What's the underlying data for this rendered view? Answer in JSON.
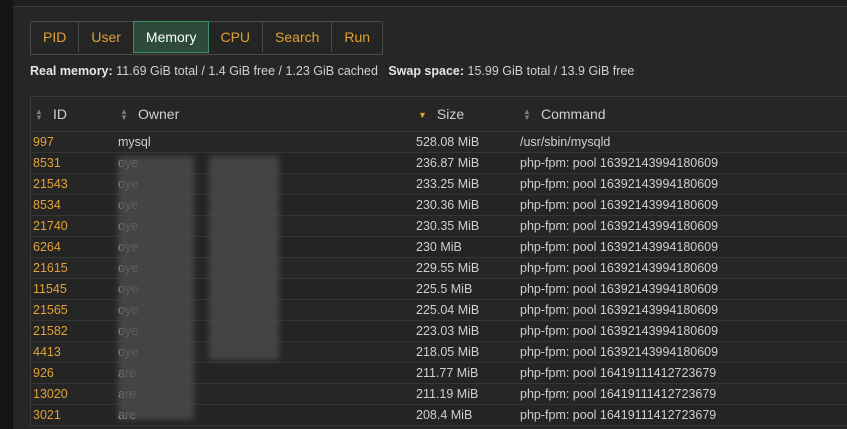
{
  "tabs": [
    {
      "label": "PID",
      "active": false
    },
    {
      "label": "User",
      "active": false
    },
    {
      "label": "Memory",
      "active": true
    },
    {
      "label": "CPU",
      "active": false
    },
    {
      "label": "Search",
      "active": false
    },
    {
      "label": "Run",
      "active": false
    }
  ],
  "memory": {
    "real_label": "Real memory:",
    "real_value": "11.69 GiB total / 1.4 GiB free / 1.23 GiB cached",
    "swap_label": "Swap space:",
    "swap_value": "15.99 GiB total / 13.9 GiB free"
  },
  "table": {
    "columns": {
      "id": "ID",
      "owner": "Owner",
      "size": "Size",
      "command": "Command"
    },
    "sorted_by": "Size",
    "rows": [
      {
        "id": "997",
        "owner": "mysql",
        "size": "528.08 MiB",
        "command": "/usr/sbin/mysqld"
      },
      {
        "id": "8531",
        "owner": "oye",
        "size": "236.87 MiB",
        "command": "php-fpm: pool 16392143994180609"
      },
      {
        "id": "21543",
        "owner": "oye",
        "size": "233.25 MiB",
        "command": "php-fpm: pool 16392143994180609"
      },
      {
        "id": "8534",
        "owner": "oye",
        "size": "230.36 MiB",
        "command": "php-fpm: pool 16392143994180609"
      },
      {
        "id": "21740",
        "owner": "oye",
        "size": "230.35 MiB",
        "command": "php-fpm: pool 16392143994180609"
      },
      {
        "id": "6264",
        "owner": "oye",
        "size": "230 MiB",
        "command": "php-fpm: pool 16392143994180609"
      },
      {
        "id": "21615",
        "owner": "oye",
        "size": "229.55 MiB",
        "command": "php-fpm: pool 16392143994180609"
      },
      {
        "id": "11545",
        "owner": "oye",
        "size": "225.5 MiB",
        "command": "php-fpm: pool 16392143994180609"
      },
      {
        "id": "21565",
        "owner": "oye",
        "size": "225.04 MiB",
        "command": "php-fpm: pool 16392143994180609"
      },
      {
        "id": "21582",
        "owner": "oye",
        "size": "223.03 MiB",
        "command": "php-fpm: pool 16392143994180609"
      },
      {
        "id": "4413",
        "owner": "oye",
        "size": "218.05 MiB",
        "command": "php-fpm: pool 16392143994180609"
      },
      {
        "id": "926",
        "owner": "are",
        "size": "211.77 MiB",
        "command": "php-fpm: pool 16419111412723679"
      },
      {
        "id": "13020",
        "owner": "are",
        "size": "211.19 MiB",
        "command": "php-fpm: pool 16419111412723679"
      },
      {
        "id": "3021",
        "owner": "are",
        "size": "208.4 MiB",
        "command": "php-fpm: pool 16419111412723679"
      }
    ]
  },
  "colors": {
    "accent": "#e1a235",
    "active_tab": "#2d4a3b",
    "background": "#262626"
  },
  "icons": {
    "sort_both": "sort-updown-icon",
    "sort_desc": "sort-desc-icon"
  }
}
